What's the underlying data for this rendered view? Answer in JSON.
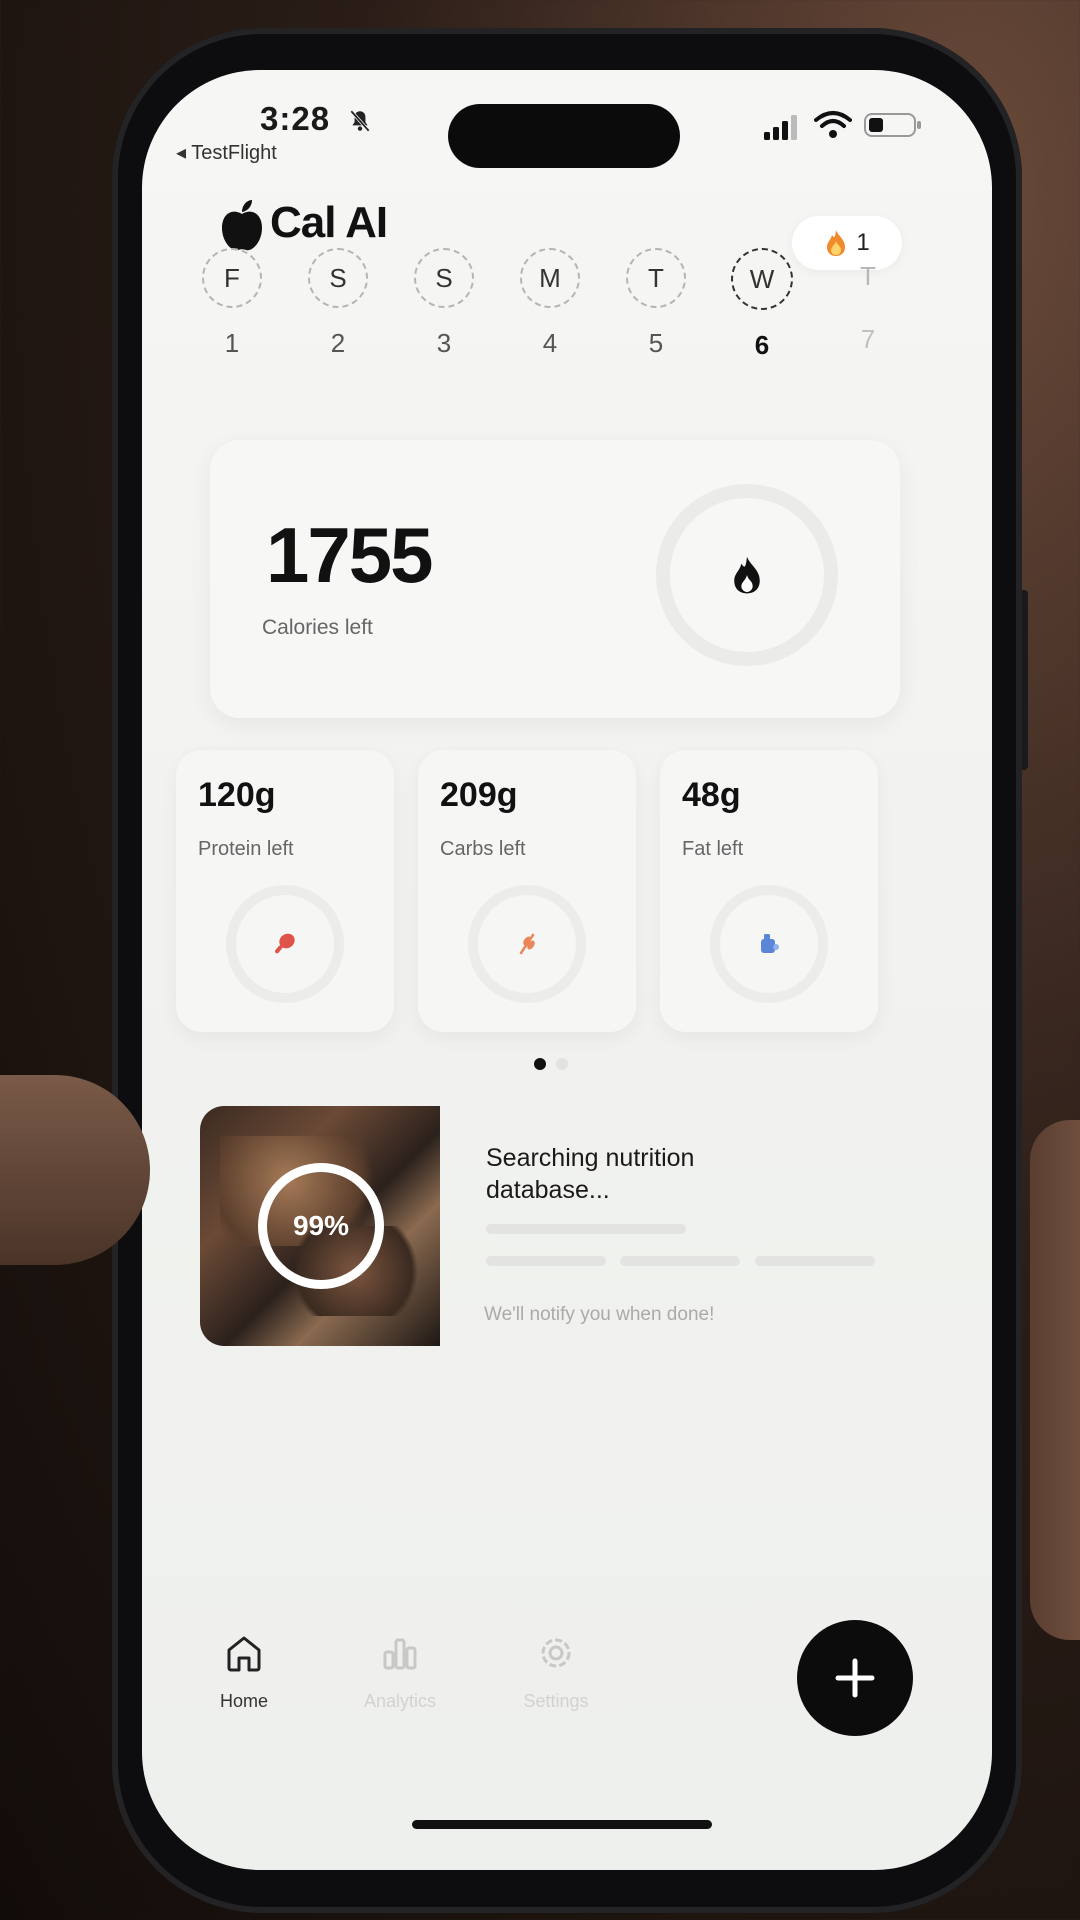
{
  "status_bar": {
    "time": "3:28",
    "back_app": "TestFlight"
  },
  "header": {
    "brand": "Cal AI",
    "streak_count": "1"
  },
  "week": [
    {
      "letter": "F",
      "num": "1",
      "state": "past"
    },
    {
      "letter": "S",
      "num": "2",
      "state": "past"
    },
    {
      "letter": "S",
      "num": "3",
      "state": "past"
    },
    {
      "letter": "M",
      "num": "4",
      "state": "past"
    },
    {
      "letter": "T",
      "num": "5",
      "state": "past"
    },
    {
      "letter": "W",
      "num": "6",
      "state": "today"
    },
    {
      "letter": "T",
      "num": "7",
      "state": "future"
    }
  ],
  "calories": {
    "value": "1755",
    "label": "Calories left"
  },
  "macros": [
    {
      "value": "120g",
      "label": "Protein left",
      "icon": "drumstick-icon",
      "color": "#e0534a"
    },
    {
      "value": "209g",
      "label": "Carbs left",
      "icon": "wheat-icon",
      "color": "#e8875a"
    },
    {
      "value": "48g",
      "label": "Fat left",
      "icon": "oil-drop-icon",
      "color": "#5b86d6"
    }
  ],
  "pager": {
    "active_page": 1,
    "total_pages": 2
  },
  "scan": {
    "progress": "99%",
    "title": "Searching nutrition database...",
    "note": "We'll notify you when done!"
  },
  "tabs": [
    {
      "label": "Home",
      "icon": "home-icon",
      "active": true
    },
    {
      "label": "Analytics",
      "icon": "analytics-icon",
      "active": false
    },
    {
      "label": "Settings",
      "icon": "settings-icon",
      "active": false
    }
  ],
  "fab": {
    "icon": "plus-icon"
  },
  "colors": {
    "accent": "#0c0c0c",
    "background": "#f3f3f1",
    "flame": "#f08a2a"
  }
}
